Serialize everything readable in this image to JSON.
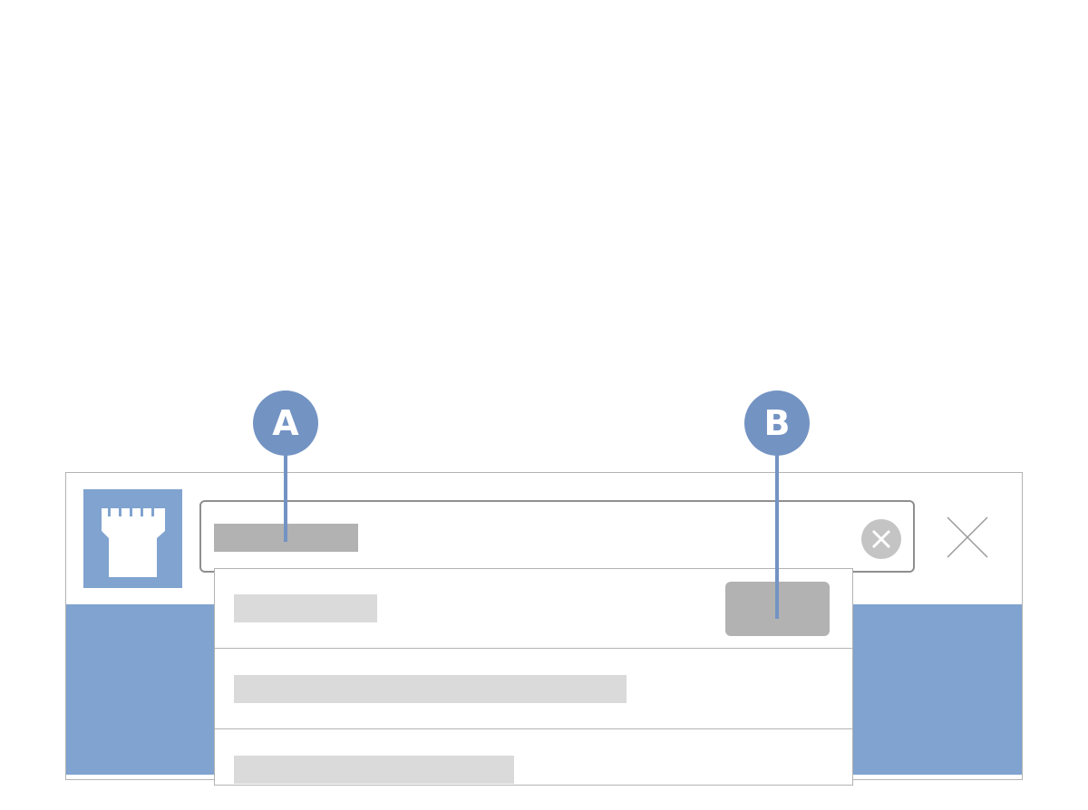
{
  "callouts": [
    {
      "label": "A"
    },
    {
      "label": "B"
    }
  ],
  "colors": {
    "accent_blue": "#80a3cf",
    "callout_blue": "#7393c3",
    "placeholder_dark": "#b2b2b2",
    "placeholder_light": "#dadada",
    "border": "#b3b3b3"
  },
  "icons": {
    "logo": "castle-tower-icon",
    "clear": "clear-circle-x-icon",
    "close": "close-x-icon"
  }
}
